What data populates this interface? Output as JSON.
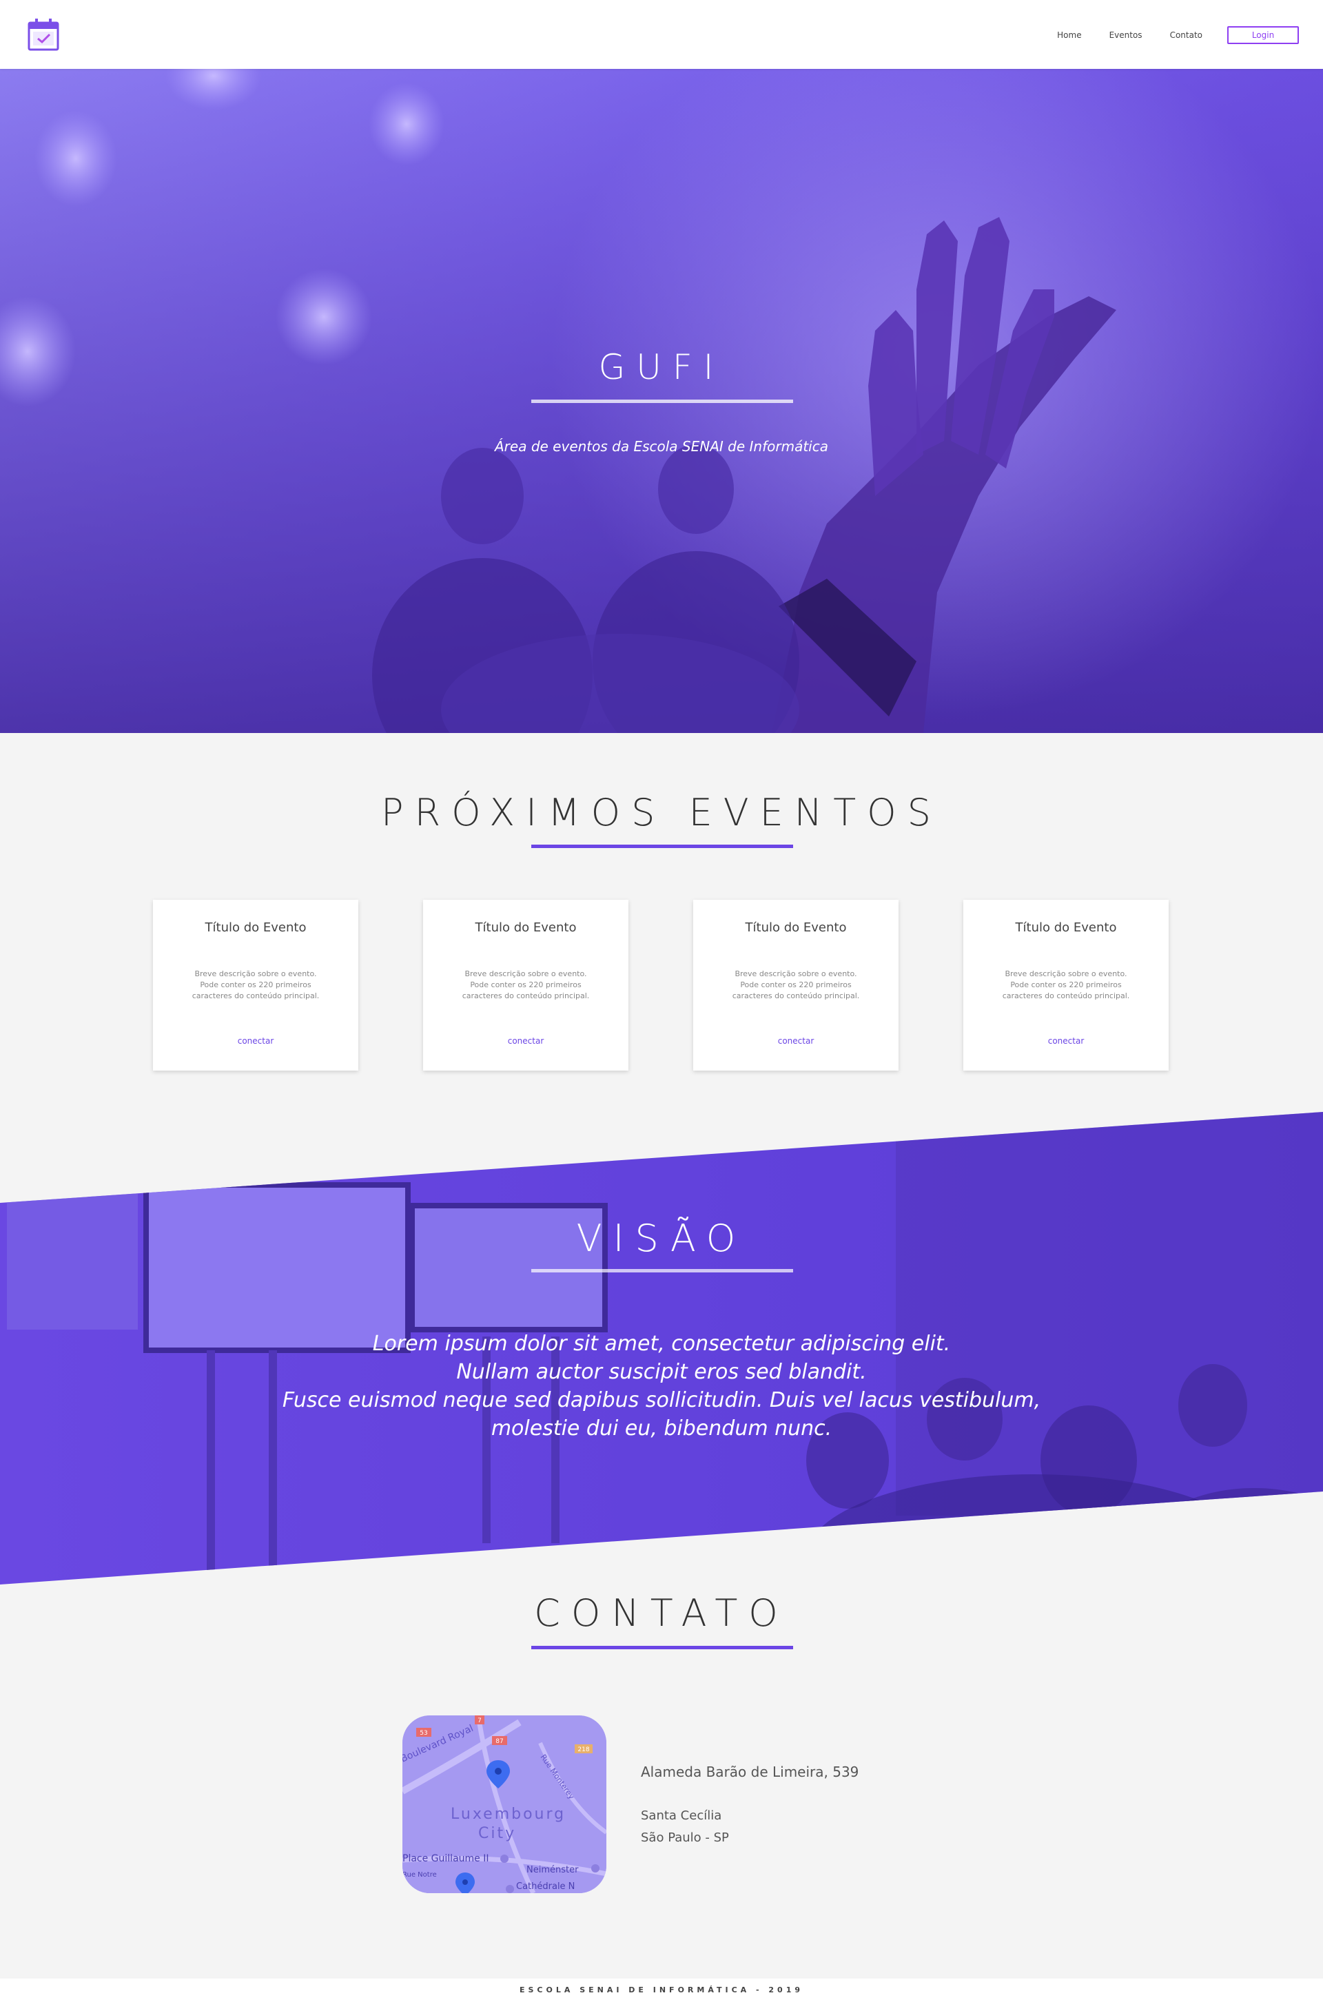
{
  "header": {
    "logo_icon": "calendar-check-icon",
    "nav": [
      "Home",
      "Eventos",
      "Contato"
    ],
    "login_label": "Login",
    "accent": "#8e3ff2"
  },
  "hero": {
    "title": "GUFI",
    "subtitle": "Área de eventos da Escola SENAI de Informática"
  },
  "events": {
    "title": "PRÓXIMOS EVENTOS",
    "cards": [
      {
        "title": "Título do Evento",
        "desc": "Breve descrição sobre o evento. Pode conter os 220 primeiros caracteres do conteúdo principal.",
        "link": "conectar"
      },
      {
        "title": "Título do Evento",
        "desc": "Breve descrição sobre o evento. Pode conter os 220 primeiros caracteres do conteúdo principal.",
        "link": "conectar"
      },
      {
        "title": "Título do Evento",
        "desc": "Breve descrição sobre o evento. Pode conter os 220 primeiros caracteres do conteúdo principal.",
        "link": "conectar"
      },
      {
        "title": "Título do Evento",
        "desc": "Breve descrição sobre o evento. Pode conter os 220 primeiros caracteres do conteúdo principal.",
        "link": "conectar"
      }
    ]
  },
  "vision": {
    "title": "VISÃO",
    "lines": [
      "Lorem ipsum dolor sit amet, consectetur adipiscing elit.",
      "Nullam auctor suscipit eros sed blandit.",
      "Fusce euismod neque sed dapibus sollicitudin. Duis vel lacus vestibulum,",
      "molestie dui eu, bibendum nunc."
    ]
  },
  "contact": {
    "title": "CONTATO",
    "address": "Alameda Barão de Limeira, 539",
    "neighborhood": "Santa Cecília",
    "city": "São Paulo - SP",
    "map": {
      "labels": [
        "Boulevard Royal",
        "Luxembourg",
        "City",
        "Place Guillaume II",
        "Neiménster",
        "Cathédrale N",
        "Rue Notre",
        "Rue Monterey"
      ],
      "road_badges": [
        "53",
        "87",
        "7",
        "218"
      ]
    }
  },
  "footer": {
    "text": "ESCOLA SENAI DE INFORMÁTICA - 2019"
  },
  "colors": {
    "primary": "#6b45e5",
    "background": "#f4f4f4",
    "overlay": "#7a63ea"
  }
}
